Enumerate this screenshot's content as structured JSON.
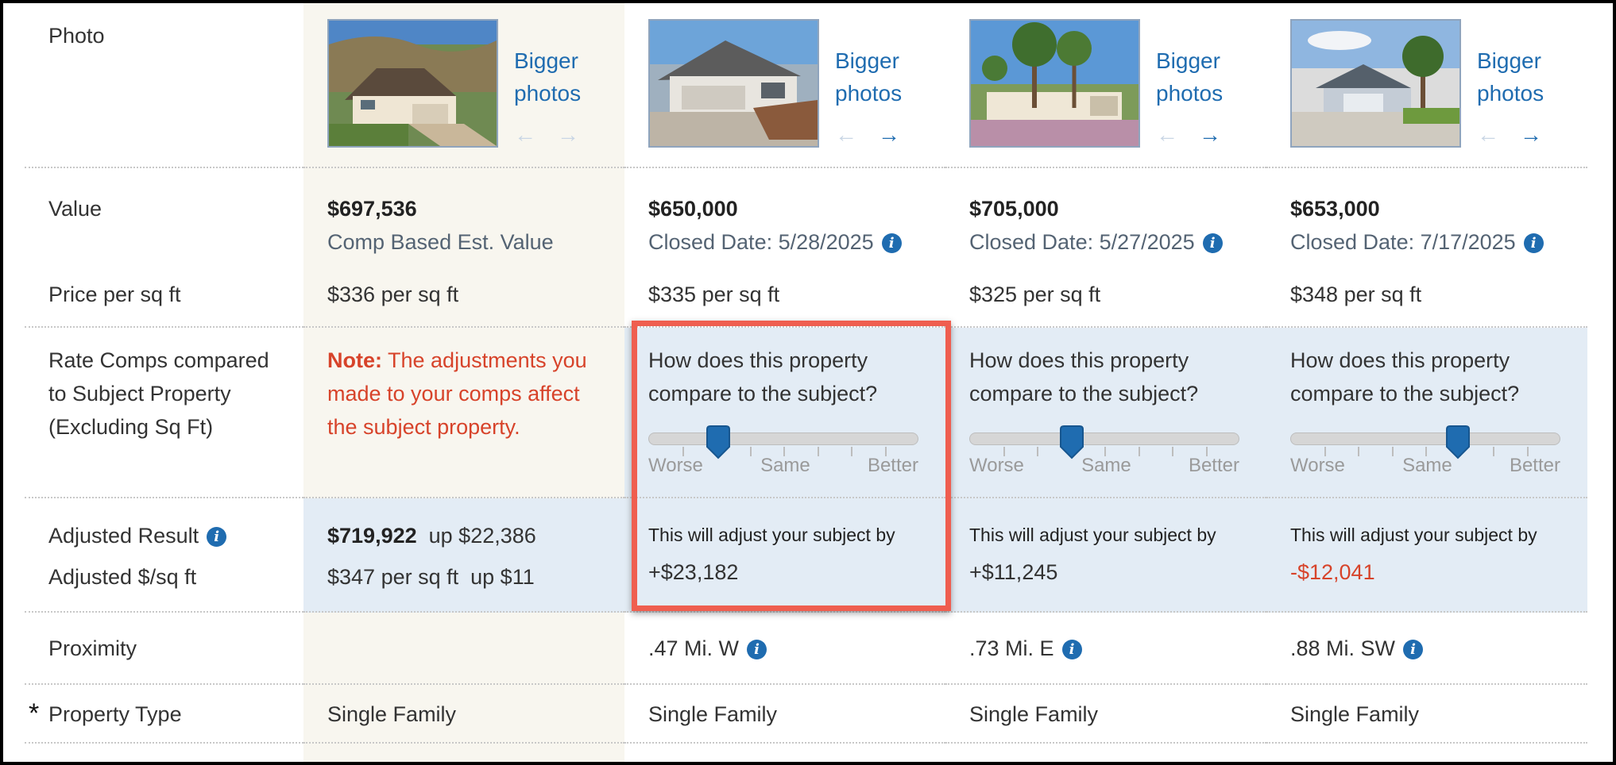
{
  "labels": {
    "photo": "Photo",
    "value": "Value",
    "price_per_sqft": "Price per sq ft",
    "rate_comps": [
      "Rate Comps compared",
      "to Subject Property",
      "(Excluding Sq Ft)"
    ],
    "adjusted_result": "Adjusted Result",
    "adjusted_sqft": "Adjusted $/sq ft",
    "proximity": "Proximity",
    "property_type": "Property Type",
    "required_marker": "*"
  },
  "photo_link": [
    "Bigger",
    "photos"
  ],
  "arrows": {
    "prev": "←",
    "next": "→"
  },
  "info_glyph": "i",
  "subject": {
    "value": "$697,536",
    "value_sub": "Comp Based Est. Value",
    "price_per_sqft": "$336 per sq ft",
    "note_label": "Note:",
    "note_text": [
      "The adjustments you",
      "made to your comps affect",
      "the subject property."
    ],
    "adjusted_value": "$719,922",
    "adjusted_change": "up $22,386",
    "adjusted_sqft": "$347 per sq ft",
    "adjusted_sqft_change": "up $11",
    "property_type": "Single Family"
  },
  "comp_question": [
    "How does this property",
    "compare to the subject?"
  ],
  "slider_labels": [
    "Worse",
    "Same",
    "Better"
  ],
  "adjust_prefix": "This will adjust your subject by",
  "comps": [
    {
      "value": "$650,000",
      "closed": "Closed Date: 5/28/2025",
      "price_per_sqft": "$335 per sq ft",
      "slider_level": 0.26,
      "adjustment": "+$23,182",
      "adjustment_negative": false,
      "proximity": ".47 Mi. W",
      "property_type": "Single Family"
    },
    {
      "value": "$705,000",
      "closed": "Closed Date: 5/27/2025",
      "price_per_sqft": "$325 per sq ft",
      "slider_level": 0.38,
      "adjustment": "+$11,245",
      "adjustment_negative": false,
      "proximity": ".73 Mi. E",
      "property_type": "Single Family"
    },
    {
      "value": "$653,000",
      "closed": "Closed Date: 7/17/2025",
      "price_per_sqft": "$348 per sq ft",
      "slider_level": 0.62,
      "adjustment": "-$12,041",
      "adjustment_negative": true,
      "proximity": ".88 Mi. SW",
      "property_type": "Single Family"
    }
  ],
  "colors": {
    "link": "#1f6cb0",
    "note": "#d7432a",
    "highlight_border": "#ef5e4f",
    "subject_bg": "#f8f6ef",
    "comp_rate_bg": "#e3ecf5"
  }
}
